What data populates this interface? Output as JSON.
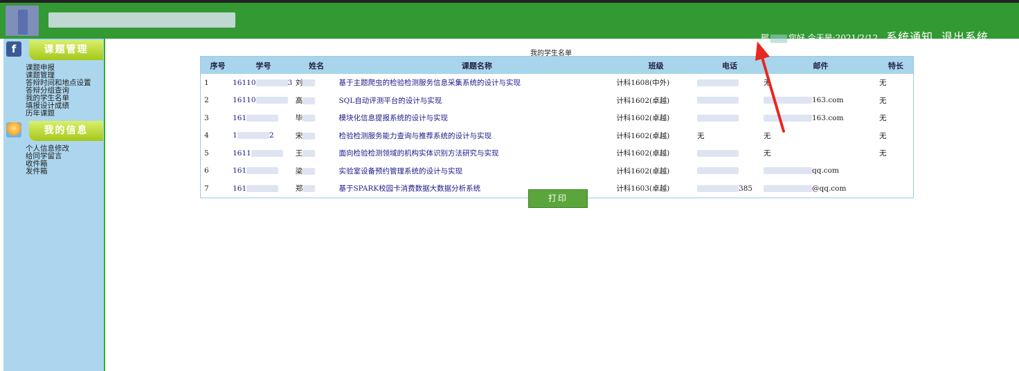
{
  "header": {
    "user_prefix": "邢",
    "greeting": "您好 今天是:2021/2/12",
    "notify_label": "系统通知",
    "logout_label": "退出系统"
  },
  "sidebar": {
    "sections": [
      {
        "title": "课题管理",
        "icon": "facebook-icon",
        "items": [
          "课题申报",
          "课题管理",
          "答辩时间和地点设置",
          "答辩分组查询",
          "我的学生名单",
          "填报设计成绩",
          "历年课题"
        ]
      },
      {
        "title": "我的信息",
        "icon": "sun-icon",
        "items": [
          "个人信息修改",
          "给同学留言",
          "收件箱",
          "发件箱"
        ]
      }
    ]
  },
  "main": {
    "caption": "我的学生名单",
    "columns": [
      "序号",
      "学号",
      "姓名",
      "课题名称",
      "班级",
      "电话",
      "邮件",
      "特长"
    ],
    "rows": [
      {
        "no": "1",
        "id": "16110",
        "id_tail": "3",
        "name": "刘",
        "topic": "基于主题爬虫的检验检测服务信息采集系统的设计与实现",
        "class": "计科1608(中外)",
        "phone": "",
        "mail": "无",
        "spec": "无"
      },
      {
        "no": "2",
        "id": "16110",
        "id_tail": "",
        "name": "高",
        "topic": "SQL自动评测平台的设计与实现",
        "class": "计科1602(卓越)",
        "phone": "",
        "mail": "163.com",
        "spec": "无"
      },
      {
        "no": "3",
        "id": "161",
        "id_tail": "",
        "name": "毕",
        "topic": "模块化信息提报系统的设计与实现",
        "class": "计科1602(卓越)",
        "phone": "",
        "mail": "163.com",
        "spec": "无"
      },
      {
        "no": "4",
        "id": "1",
        "id_tail": "2",
        "name": "宋",
        "topic": "检验检测服务能力查询与推荐系统的设计与实现",
        "class": "计科1602(卓越)",
        "phone": "无",
        "mail": "无",
        "spec": "无"
      },
      {
        "no": "5",
        "id": "1611",
        "id_tail": "",
        "name": "王",
        "topic": "面向检验检测领域的机构实体识别方法研究与实现",
        "class": "计科1602(卓越)",
        "phone": "",
        "mail": "无",
        "spec": "无"
      },
      {
        "no": "6",
        "id": "161",
        "id_tail": "",
        "name": "梁",
        "topic": "实验室设备预约管理系统的设计与实现",
        "class": "计科1602(卓越)",
        "phone": "",
        "mail": "qq.com",
        "spec": ""
      },
      {
        "no": "7",
        "id": "161",
        "id_tail": "",
        "name": "郑",
        "topic": "基于SPARK校园卡消费数据大数据分析系统",
        "class": "计科1603(卓越)",
        "phone": "385",
        "mail": "@qq.com",
        "spec": ""
      }
    ],
    "print_label": "打印"
  },
  "colors": {
    "header_green": "#339933",
    "sidebar_blue": "#acd6ee",
    "table_header": "#a9d5ec",
    "button_green": "#5aa63a",
    "arrow_red": "#e8271e"
  }
}
